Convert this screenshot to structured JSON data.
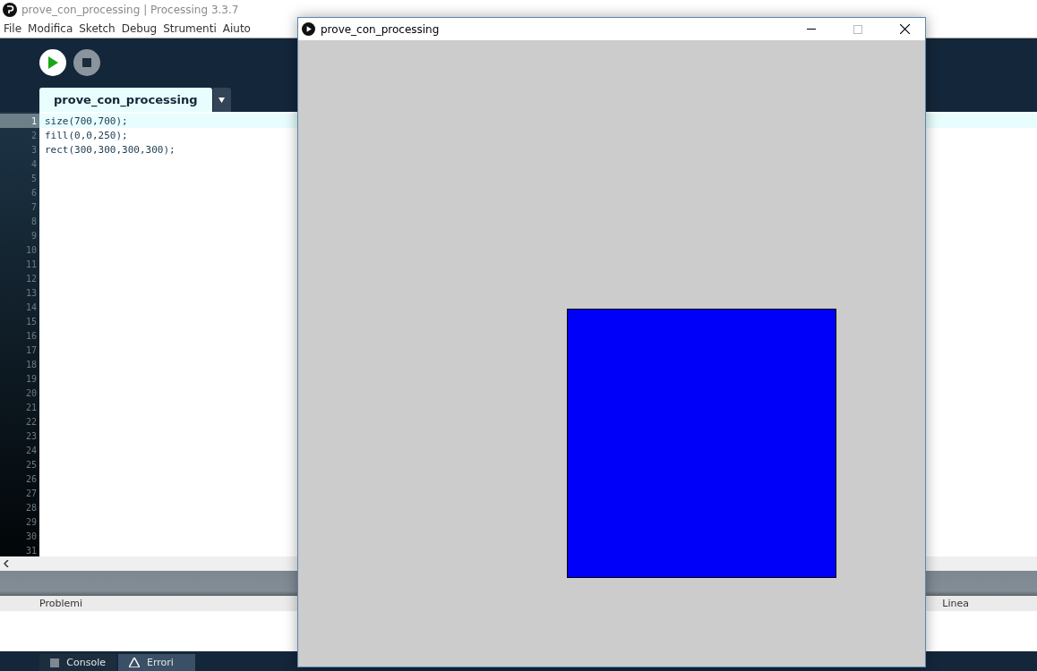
{
  "window": {
    "title": "prove_con_processing | Processing 3.3.7"
  },
  "menu": [
    "File",
    "Modifica",
    "Sketch",
    "Debug",
    "Strumenti",
    "Aiuto"
  ],
  "editor_tabs": [
    {
      "label": "prove_con_processing",
      "selected": true
    }
  ],
  "editor": {
    "lines": [
      {
        "number": "1",
        "code": "size(700,700);",
        "selected": true
      },
      {
        "number": "2",
        "code": "fill(0,0,250);",
        "selected": false
      },
      {
        "number": "3",
        "code": "rect(300,300,300,300);",
        "selected": false
      },
      {
        "number": "4",
        "selected": false
      },
      {
        "number": "5",
        "selected": false
      },
      {
        "number": "6",
        "selected": false
      },
      {
        "number": "7",
        "selected": false
      },
      {
        "number": "8",
        "selected": false
      },
      {
        "number": "9",
        "selected": false
      },
      {
        "number": "10",
        "selected": false
      },
      {
        "number": "11",
        "selected": false
      },
      {
        "number": "12",
        "selected": false
      },
      {
        "number": "13",
        "selected": false
      },
      {
        "number": "14",
        "selected": false
      },
      {
        "number": "15",
        "selected": false
      },
      {
        "number": "16",
        "selected": false
      },
      {
        "number": "17",
        "selected": false
      },
      {
        "number": "18",
        "selected": false
      },
      {
        "number": "19",
        "selected": false
      },
      {
        "number": "20",
        "selected": false
      },
      {
        "number": "21",
        "selected": false
      },
      {
        "number": "22",
        "selected": false
      },
      {
        "number": "23",
        "selected": false
      },
      {
        "number": "24",
        "selected": false
      },
      {
        "number": "25",
        "selected": false
      },
      {
        "number": "26",
        "selected": false
      },
      {
        "number": "27",
        "selected": false
      },
      {
        "number": "28",
        "selected": false
      },
      {
        "number": "29",
        "selected": false
      },
      {
        "number": "30",
        "selected": false
      },
      {
        "number": "31",
        "selected": false
      }
    ]
  },
  "problems_table": {
    "columns": [
      "Problemi",
      "Linea"
    ]
  },
  "console_tabs": [
    {
      "label": "Console",
      "selected": false
    },
    {
      "label": "Errori",
      "selected": true
    }
  ],
  "sketch_window": {
    "title": "prove_con_processing"
  }
}
